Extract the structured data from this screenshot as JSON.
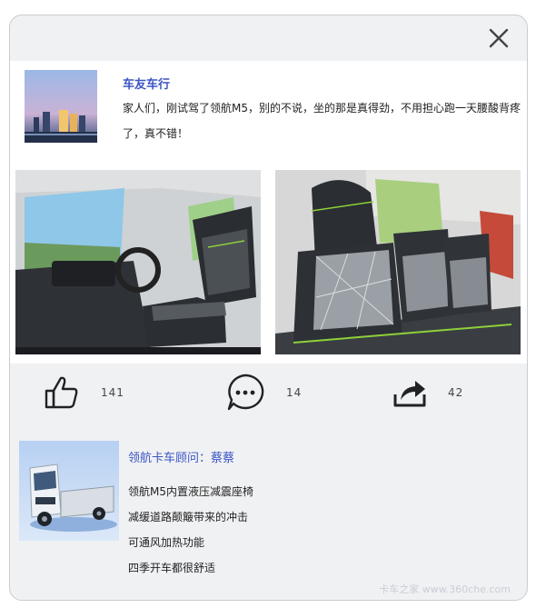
{
  "post": {
    "author": "车友车行",
    "text": "家人们，刚试驾了领航M5，别的不说，坐的那是真得劲，不用担心跑一天腰酸背疼了，真不错！"
  },
  "actions": {
    "like_count": "141",
    "comment_count": "14",
    "share_count": "42"
  },
  "reply": {
    "author": "领航卡车顾问：蔡蔡",
    "lines": [
      "领航M5内置液压减震座椅",
      "减缓道路颠簸带来的冲击",
      "可通风加热功能",
      "四季开车都很舒适"
    ]
  },
  "watermark": "卡车之家 www.360che.com",
  "icons": [
    "close-icon",
    "thumbs-up-icon",
    "comment-icon",
    "share-icon"
  ],
  "colors": {
    "accent": "#3b55c4",
    "card_bg": "#f0f1f3",
    "seat_stitch": "#8dd13a"
  }
}
